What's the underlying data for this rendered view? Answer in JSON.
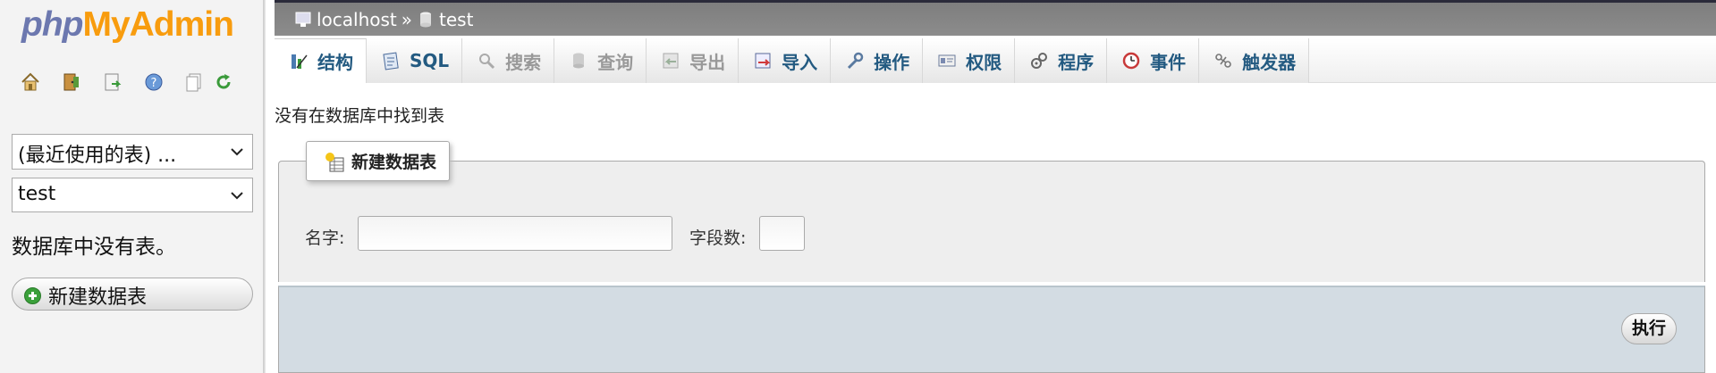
{
  "logo": {
    "part1": "php",
    "part2": "MyAdmin"
  },
  "nav": {
    "icons": [
      "home-icon",
      "logout-icon",
      "query-window-icon",
      "docs-icon",
      "sql-docs-icon",
      "reload-icon"
    ],
    "recent_tables": "(最近使用的表) ...",
    "database": "test",
    "no_tables_text": "数据库中没有表。",
    "new_table": "新建数据表"
  },
  "breadcrumb": {
    "server": "localhost",
    "separator": "»",
    "database": "test"
  },
  "tabs": [
    {
      "label": "结构",
      "icon": "structure-icon",
      "state": "active"
    },
    {
      "label": "SQL",
      "icon": "sql-icon",
      "state": "normal"
    },
    {
      "label": "搜索",
      "icon": "search-icon",
      "state": "disabled"
    },
    {
      "label": "查询",
      "icon": "query-icon",
      "state": "disabled"
    },
    {
      "label": "导出",
      "icon": "export-icon",
      "state": "disabled"
    },
    {
      "label": "导入",
      "icon": "import-icon",
      "state": "normal"
    },
    {
      "label": "操作",
      "icon": "wrench-icon",
      "state": "normal"
    },
    {
      "label": "权限",
      "icon": "privileges-icon",
      "state": "normal"
    },
    {
      "label": "程序",
      "icon": "routines-icon",
      "state": "normal"
    },
    {
      "label": "事件",
      "icon": "events-icon",
      "state": "normal"
    },
    {
      "label": "触发器",
      "icon": "triggers-icon",
      "state": "normal"
    }
  ],
  "main": {
    "message": "没有在数据库中找到表",
    "create_table": {
      "legend": "新建数据表",
      "name_label": "名字:",
      "name_value": "",
      "columns_label": "字段数:",
      "columns_value": "",
      "go_button": "执行"
    }
  },
  "colors": {
    "link": "#235a81",
    "topbar": "#848484",
    "footer": "#d3dce3",
    "logo_php": "#6c78af",
    "logo_myadmin": "#f89c0e"
  }
}
